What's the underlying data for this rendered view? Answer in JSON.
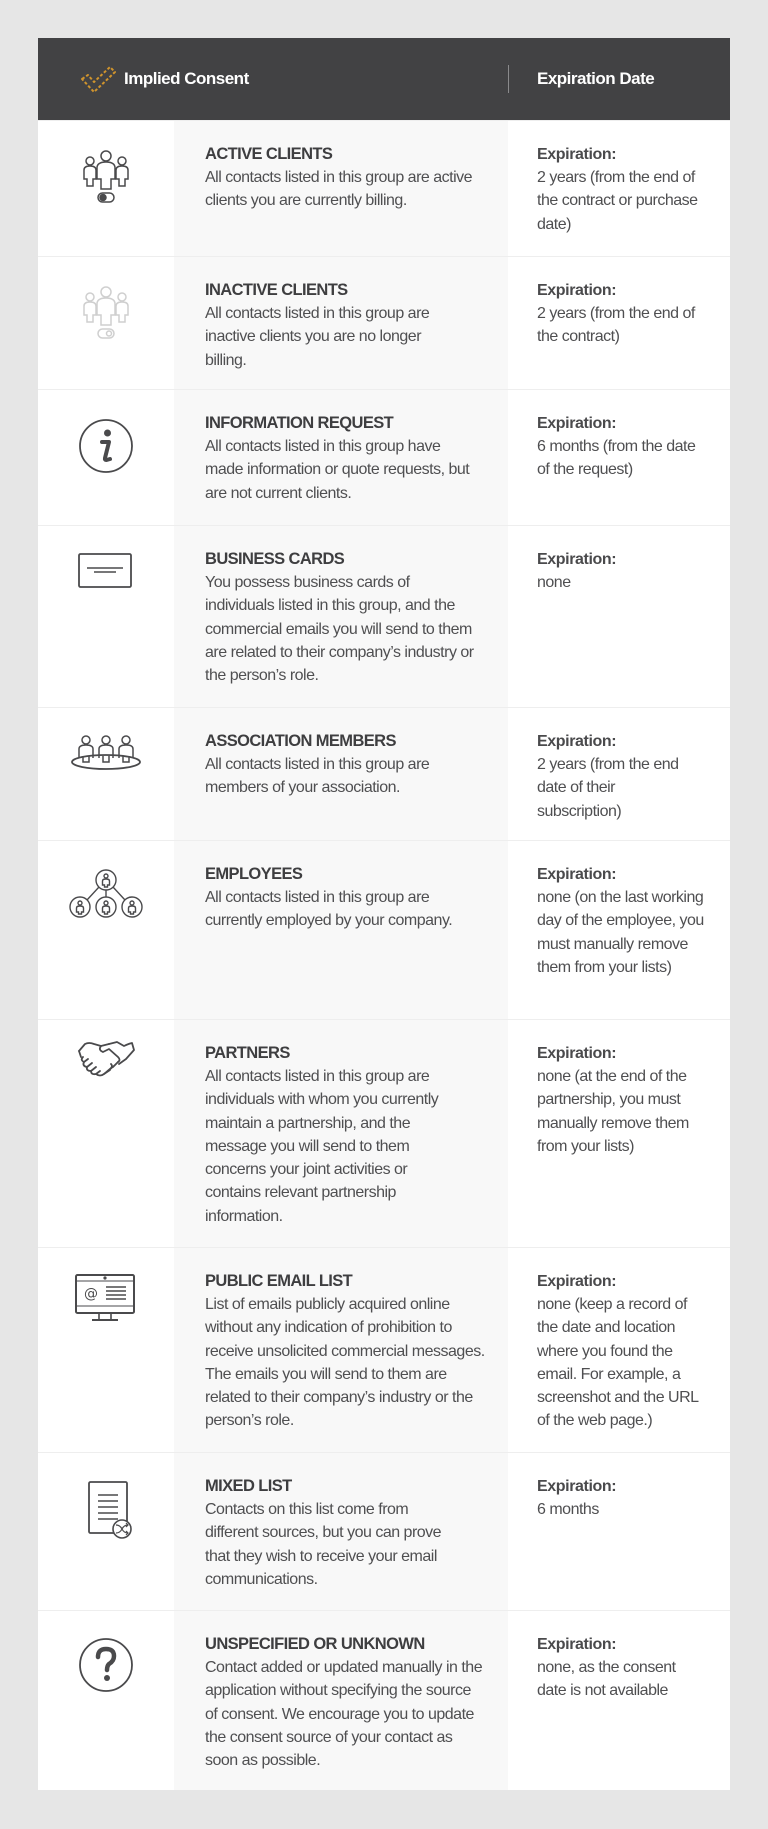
{
  "header": {
    "title": "Implied Consent",
    "expiration_heading": "Expiration Date",
    "icon": "dashed-checkmark-icon",
    "accent_color": "#d0942d",
    "background_color": "#424244"
  },
  "expiration_label": "Expiration:",
  "rows": [
    {
      "icon": "active-clients-icon",
      "title": "ACTIVE CLIENTS",
      "description": "All contacts listed in this group are active clients you are currently billing.",
      "expiration": "2 years (from the end of the contract or purchase date)"
    },
    {
      "icon": "inactive-clients-icon",
      "title": "INACTIVE CLIENTS",
      "description": "All contacts listed in this group are inactive clients you are no longer billing.",
      "expiration": "2 years (from the end of the contract)"
    },
    {
      "icon": "info-icon",
      "title": "INFORMATION REQUEST",
      "description": "All contacts listed in this group have made information or quote requests, but are not current clients.",
      "expiration": "6 months (from the date of the request)"
    },
    {
      "icon": "business-card-icon",
      "title": "BUSINESS CARDS",
      "description": "You possess business cards of individuals listed in this group, and the commercial emails you will send to them are related to their company’s industry or the person’s role.",
      "expiration": "none"
    },
    {
      "icon": "association-icon",
      "title": "ASSOCIATION MEMBERS",
      "description": "All contacts listed in this group are members of your association.",
      "expiration": "2 years (from the end date of their subscription)"
    },
    {
      "icon": "org-chart-icon",
      "title": "EMPLOYEES",
      "description": "All contacts listed in this group are currently employed by your company.",
      "expiration": "none (on the last working day of the employee, you must manually remove them from your lists)"
    },
    {
      "icon": "handshake-icon",
      "title": "PARTNERS",
      "description": "All contacts listed in this group are individuals with whom you currently maintain a partnership, and the message you will send to them concerns your joint activities or contains relevant partnership information.",
      "expiration": "none (at the end of the partnership, you must manually remove them from your lists)"
    },
    {
      "icon": "monitor-email-icon",
      "title": "PUBLIC EMAIL LIST",
      "description": "List of emails publicly acquired online without any indication of prohibition to receive unsolicited commercial messages. The emails you will send to them are related to their company’s industry or the person’s role.",
      "expiration": "none (keep a record of the date and location where you found the email. For example, a screenshot and the URL of the web page.)"
    },
    {
      "icon": "document-shuffle-icon",
      "title": "MIXED LIST",
      "description": "Contacts on this list come from different sources, but you can prove that they wish to receive your email communications.",
      "expiration": "6 months"
    },
    {
      "icon": "question-icon",
      "title": "UNSPECIFIED OR UNKNOWN",
      "description": "Contact added or updated manually in the application without specifying the source of consent. We encourage you to update the consent source of your contact as soon as possible.",
      "expiration": "none, as the consent date is not available"
    }
  ]
}
